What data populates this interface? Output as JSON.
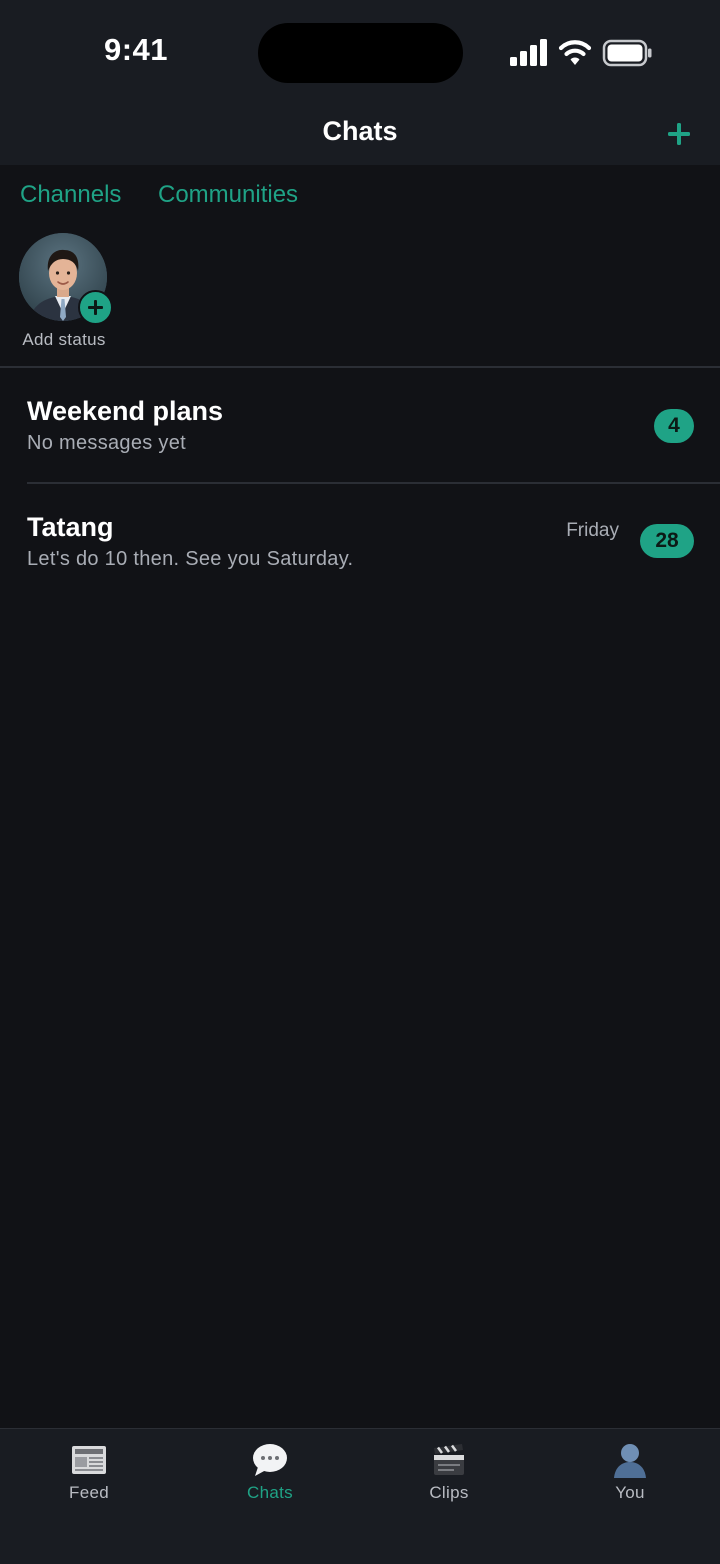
{
  "status_bar": {
    "time": "9:41"
  },
  "header": {
    "title": "Chats",
    "new_chat_icon": "plus-icon"
  },
  "links": {
    "channels": "Channels",
    "communities": "Communities"
  },
  "status": {
    "add_label": "Add status"
  },
  "chats": [
    {
      "name": "Weekend plans",
      "preview": "No messages yet",
      "time": "",
      "unread": "4"
    },
    {
      "name": "Tatang",
      "preview": "Let's do 10 then. See you Saturday.",
      "time": "Friday",
      "unread": "28"
    }
  ],
  "tab_bar": {
    "items": [
      {
        "label": "Feed",
        "icon": "newspaper-icon"
      },
      {
        "label": "Chats",
        "icon": "speech-bubble-icon",
        "active": true
      },
      {
        "label": "Clips",
        "icon": "clapperboard-icon"
      },
      {
        "label": "You",
        "icon": "person-icon"
      }
    ]
  },
  "colors": {
    "accent": "#1fa386",
    "background": "#111216",
    "header_background": "#191c22",
    "secondary_text": "#a9adb5"
  }
}
